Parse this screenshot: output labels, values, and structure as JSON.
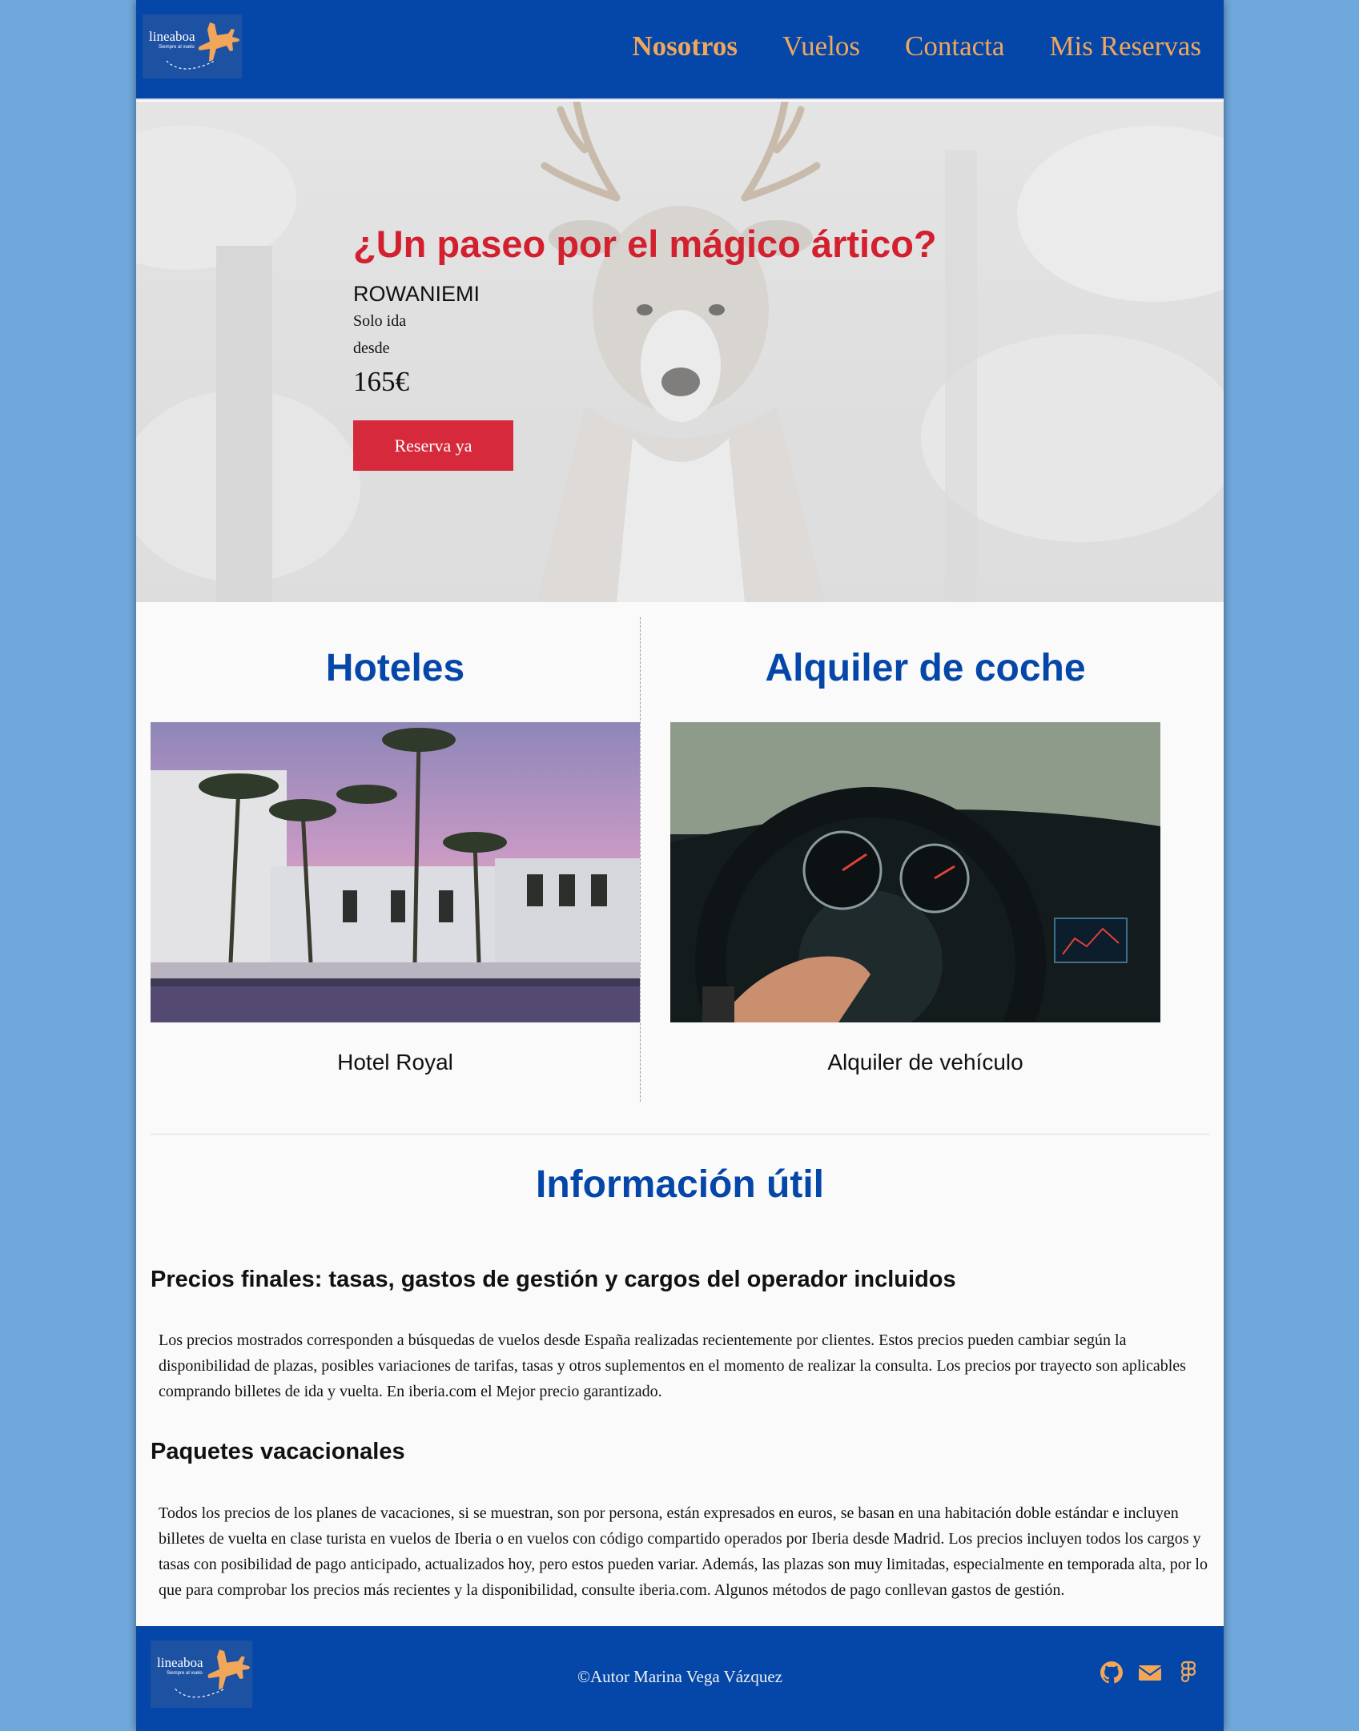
{
  "header": {
    "logo": {
      "brand": "lineaboa",
      "tagline": "Siempre al vuelo"
    },
    "nav": [
      "Nosotros",
      "Vuelos",
      "Contacta",
      "Mis Reservas"
    ]
  },
  "hero": {
    "title": "¿Un paseo por el mágico ártico?",
    "destination": "ROWANIEMI",
    "trip_type": "Solo ida",
    "from_label": "desde",
    "price": "165€",
    "button": "Reserva ya"
  },
  "services": {
    "hotels": {
      "title": "Hoteles",
      "caption": "Hotel Royal"
    },
    "cars": {
      "title": "Alquiler de coche",
      "caption": "Alquiler de vehículo"
    }
  },
  "info": {
    "title": "Información útil",
    "sections": [
      {
        "heading": "Precios finales: tasas, gastos de gestión y cargos del operador incluidos",
        "text": "Los precios mostrados corresponden a búsquedas de vuelos desde España realizadas recientemente por clientes. Estos precios pueden cambiar según la disponibilidad de plazas, posibles variaciones de tarifas, tasas y otros suplementos en el momento de realizar la consulta. Los precios por trayecto son aplicables comprando billetes de ida y vuelta. En iberia.com el Mejor precio garantizado."
      },
      {
        "heading": "Paquetes vacacionales",
        "text": "Todos los precios de los planes de vacaciones, si se muestran, son por persona, están expresados en euros, se basan en una habitación doble estándar e incluyen billetes de vuelta en clase turista en vuelos de Iberia o en vuelos con código compartido operados por Iberia desde Madrid. Los precios incluyen todos los cargos y tasas con posibilidad de pago anticipado, actualizados hoy, pero estos pueden variar. Además, las plazas son muy limitadas, especialmente en temporada alta, por lo que para comprobar los precios más recientes y la disponibilidad, consulte iberia.com. Algunos métodos de pago conllevan gastos de gestión."
      }
    ]
  },
  "footer": {
    "copyright": "©Autor Marina Vega Vázquez",
    "social_icons": [
      "github-icon",
      "envelope-icon",
      "figma-icon"
    ]
  },
  "colors": {
    "brand_blue": "#0447a8",
    "accent_orange": "#f2a65a",
    "hero_red": "#d3202f",
    "page_bg": "#6fa8dc"
  }
}
